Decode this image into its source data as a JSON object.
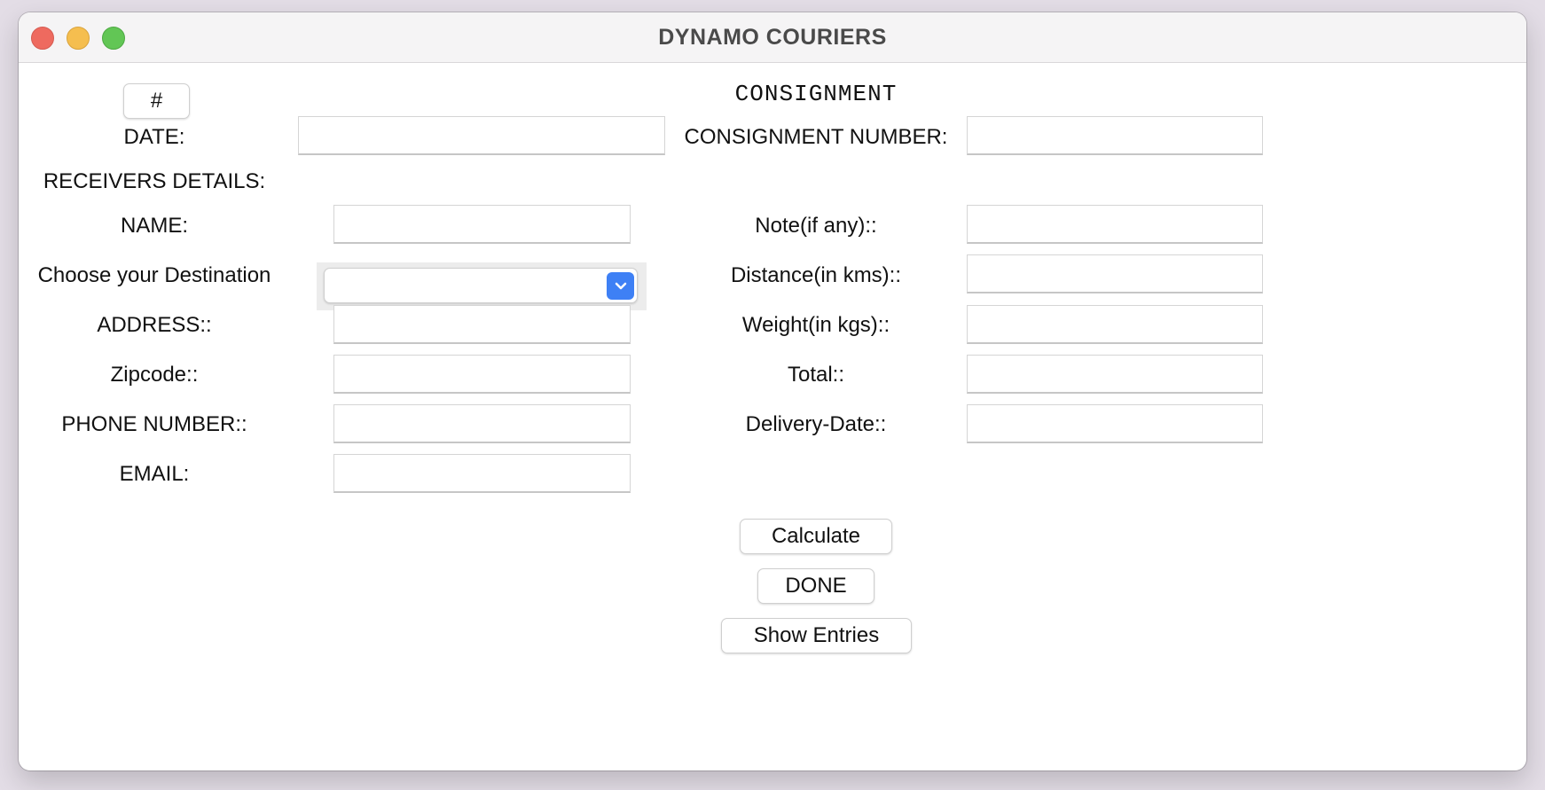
{
  "window": {
    "title": "DYNAMO COURIERS"
  },
  "form": {
    "hash_button": "#",
    "heading": "CONSIGNMENT",
    "date_label": "DATE:",
    "date_value": "",
    "consignment_number_label": "CONSIGNMENT NUMBER:",
    "consignment_number_value": "",
    "receivers_details_label": "RECEIVERS DETAILS:",
    "name_label": "NAME:",
    "name_value": "",
    "destination_label": "Choose your Destination",
    "destination_value": "",
    "address_label": "ADDRESS::",
    "address_value": "",
    "zipcode_label": "Zipcode::",
    "zipcode_value": "",
    "phone_label": "PHONE NUMBER::",
    "phone_value": "",
    "email_label": "EMAIL:",
    "email_value": "",
    "note_label": "Note(if any)::",
    "note_value": "",
    "distance_label": "Distance(in kms)::",
    "distance_value": "",
    "weight_label": "Weight(in kgs)::",
    "weight_value": "",
    "total_label": "Total::",
    "total_value": "",
    "delivery_date_label": "Delivery-Date::",
    "delivery_date_value": ""
  },
  "buttons": {
    "calculate": "Calculate",
    "done": "DONE",
    "show_entries": "Show Entries"
  },
  "icons": {
    "close": "close-icon",
    "minimize": "minimize-icon",
    "zoom": "zoom-icon",
    "dropdown": "chevron-down-icon"
  },
  "colors": {
    "close": "#ee6a5f",
    "minimize": "#f5be4f",
    "zoom": "#62c655",
    "dropdown_accent": "#3e80f5"
  }
}
